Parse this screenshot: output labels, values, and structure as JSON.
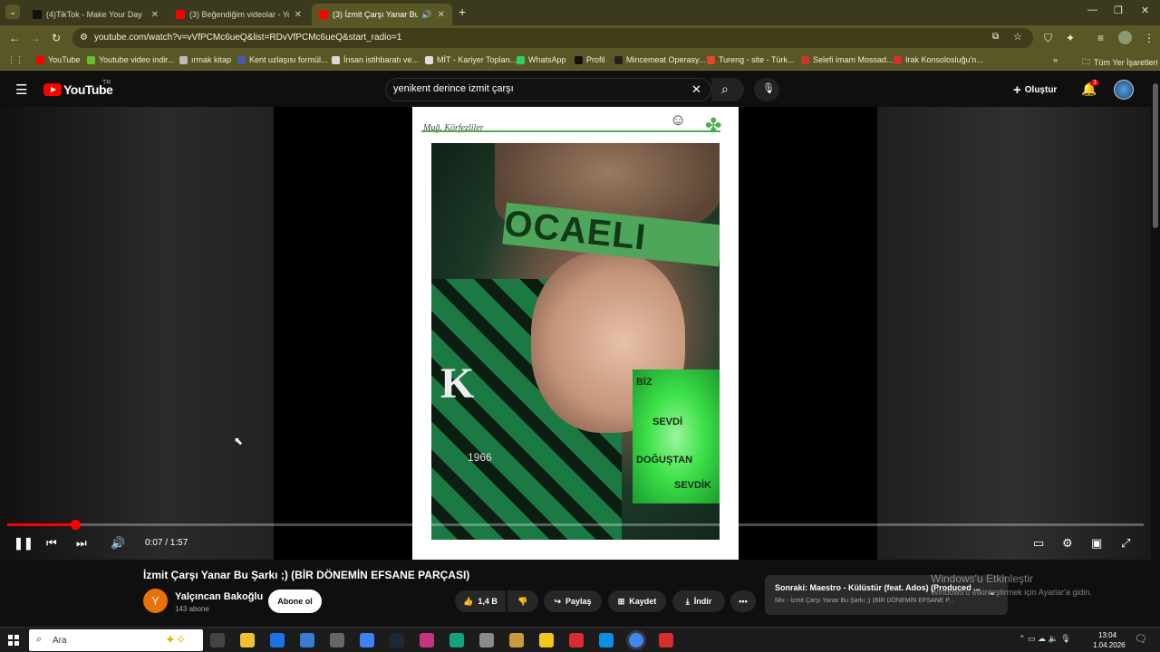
{
  "tabs": [
    {
      "title": "(4)TikTok - Make Your Day",
      "color": "#111111"
    },
    {
      "title": "(3) Beğendiğim videolar - YouT",
      "color": "#ff0000"
    },
    {
      "title": "(3) İzmit Çarşı Yanar Bu Şarkı",
      "color": "#ff0000"
    }
  ],
  "address": {
    "url": "youtube.com/watch?v=vVfPCMc6ueQ&list=RDvVfPCMc6ueQ&start_radio=1"
  },
  "bookmarks": [
    {
      "label": "YouTube",
      "color": "#ff0000"
    },
    {
      "label": "Youtube video indir...",
      "color": "#6abf2e"
    },
    {
      "label": "ırmak kitap",
      "color": "#bbbbbb"
    },
    {
      "label": "Kent uzlaşısı formül...",
      "color": "#4a5aa8"
    },
    {
      "label": "İnsan istihbaratı ve...",
      "color": "#d9d9d9"
    },
    {
      "label": "MİT - Kariyer Toplan...",
      "color": "#dddddd"
    },
    {
      "label": "WhatsApp",
      "color": "#25d366"
    },
    {
      "label": "Profil",
      "color": "#111111"
    },
    {
      "label": "Mincemeat Operasy...",
      "color": "#222222"
    },
    {
      "label": "Tureng - site - Türk...",
      "color": "#e0472d"
    },
    {
      "label": "Selefi imam Mossad...",
      "color": "#c0392b"
    },
    {
      "label": "Irak Konsolosluğu'n...",
      "color": "#d63031"
    }
  ],
  "bookmarks_more": "»",
  "bookmarks_all": "Tüm Yer İşaretleri",
  "youtube": {
    "logo_text": "YouTube",
    "region": "TR",
    "search_value": "yenikent derince izmit çarşı",
    "create_label": "Oluştur",
    "notif_count": "3"
  },
  "video": {
    "frame_signature": "Muğ. Körfezliler",
    "band_text": "OCAELI",
    "k_letter": "K",
    "year": "1966",
    "overlay_lines": [
      "BİZ",
      "SEVDİ",
      "DOĞUŞTAN",
      "SEVDİK"
    ],
    "time": "0:07 / 1:57",
    "progress": 0.06
  },
  "meta": {
    "title": "İzmit Çarşı Yanar Bu Şarkı ;) (BİR DÖNEMİN EFSANE PARÇASI)",
    "avatar_letter": "Y",
    "channel": "Yalçıncan Bakoğlu",
    "subscribers": "143 abone",
    "subscribe": "Abone ol",
    "likes": "1,4 B",
    "share": "Paylaş",
    "save": "Kaydet",
    "download": "İndir",
    "more": "•••"
  },
  "next": {
    "line1": "Sonraki: Maestro - Külüstür (feat. Ados) (Produced ...",
    "line2": "Mix - İzmit Çarşı Yanar Bu Şarkı ;) (BİR DÖNEMİN EFSANE P..."
  },
  "windows_watermark": {
    "title": "Windows'u Etkinleştir",
    "subtitle": "Windows'u etkinleştirmek için Ayarlar'a gidin."
  },
  "taskbar": {
    "search_placeholder": "Ara",
    "time": "13:04",
    "date": "1.04.2026",
    "icons": [
      {
        "name": "task-view-icon",
        "color": "#444444"
      },
      {
        "name": "file-explorer-icon",
        "color": "#f2c12e"
      },
      {
        "name": "outlook-icon",
        "color": "#1a73e8"
      },
      {
        "name": "store-icon",
        "color": "#3a7bd5"
      },
      {
        "name": "settings-icon",
        "color": "#666666"
      },
      {
        "name": "remote-icon",
        "color": "#3b82f6"
      },
      {
        "name": "steam-icon",
        "color": "#1b2838"
      },
      {
        "name": "instagram-icon",
        "color": "#c13584"
      },
      {
        "name": "chatgpt-icon",
        "color": "#10a37f"
      },
      {
        "name": "app-icon",
        "color": "#8a8a8a"
      },
      {
        "name": "lol-icon",
        "color": "#c89b3c"
      },
      {
        "name": "vpn-icon",
        "color": "#f5c518"
      },
      {
        "name": "discord-icon",
        "color": "#d92c2c"
      },
      {
        "name": "edge-icon",
        "color": "#0c8ee3"
      },
      {
        "name": "chrome-icon",
        "color": "#4285f4"
      },
      {
        "name": "acrobat-icon",
        "color": "#d92c2c"
      }
    ]
  }
}
